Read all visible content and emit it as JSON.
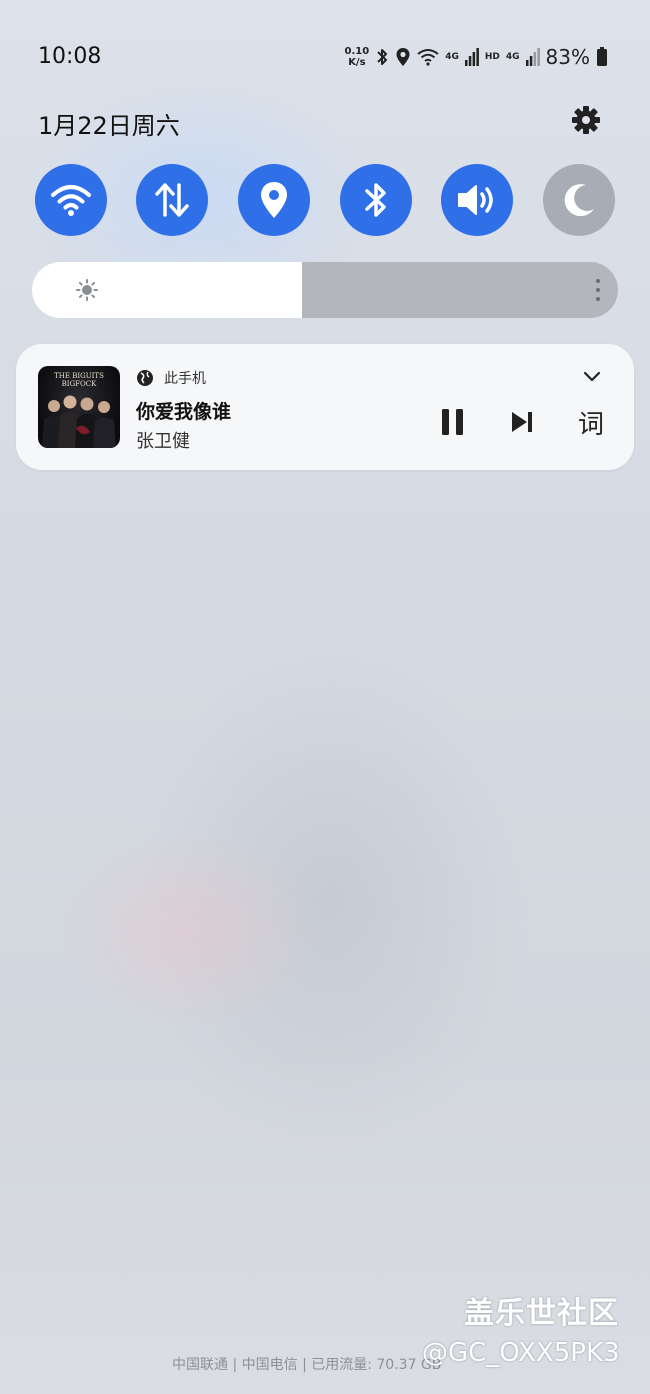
{
  "status_bar": {
    "time": "10:08",
    "net_speed_value": "0.10",
    "net_speed_unit": "K/s",
    "net1_label": "4G",
    "hd_label": "HD",
    "net2_label": "4G",
    "battery": "83%",
    "icons": [
      "bluetooth-icon",
      "location-icon",
      "wifi-icon",
      "signal-icon",
      "signal-icon",
      "battery-icon"
    ]
  },
  "header": {
    "date": "1月22日周六",
    "settings_icon": "gear-icon"
  },
  "quick_toggles": [
    {
      "name": "wifi",
      "icon": "wifi-icon",
      "active": true
    },
    {
      "name": "mobile-data",
      "icon": "data-arrows-icon",
      "active": true
    },
    {
      "name": "location",
      "icon": "location-icon",
      "active": true
    },
    {
      "name": "bluetooth",
      "icon": "bluetooth-icon",
      "active": true
    },
    {
      "name": "sound",
      "icon": "volume-icon",
      "active": true
    },
    {
      "name": "dark-mode",
      "icon": "moon-icon",
      "active": false
    }
  ],
  "brightness": {
    "level": 0.46
  },
  "media": {
    "source": "此手机",
    "title": "你爱我像谁",
    "artist": "张卫健",
    "album_text": "THE BIGUITS BIGFOCK",
    "lyrics_label": "词"
  },
  "footer": {
    "carrier_text": "中国联通 | 中国电信 | 已用流量: 70.37 GB"
  },
  "watermark": {
    "line1": "盖乐世社区",
    "line2": "@GC_OXX5PK3"
  },
  "colors": {
    "accent": "#2f6fe8",
    "toggle_off": "#a8adb5",
    "card": "#f6f7f9"
  }
}
